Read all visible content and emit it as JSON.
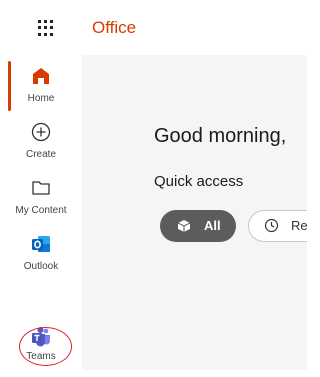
{
  "header": {
    "brand": "Office"
  },
  "rail": {
    "items": [
      {
        "label": "Home"
      },
      {
        "label": "Create"
      },
      {
        "label": "My Content"
      },
      {
        "label": "Outlook"
      },
      {
        "label": "Teams"
      }
    ]
  },
  "main": {
    "greeting": "Good morning,",
    "quick_access_title": "Quick access",
    "filters": [
      {
        "label": "All",
        "selected": true
      },
      {
        "label": "Re",
        "selected": false
      }
    ]
  },
  "colors": {
    "brand": "#d83b01",
    "selected_pill": "#5c5c5c",
    "main_bg": "#f5f5f5",
    "highlight": "#e11d2a"
  }
}
